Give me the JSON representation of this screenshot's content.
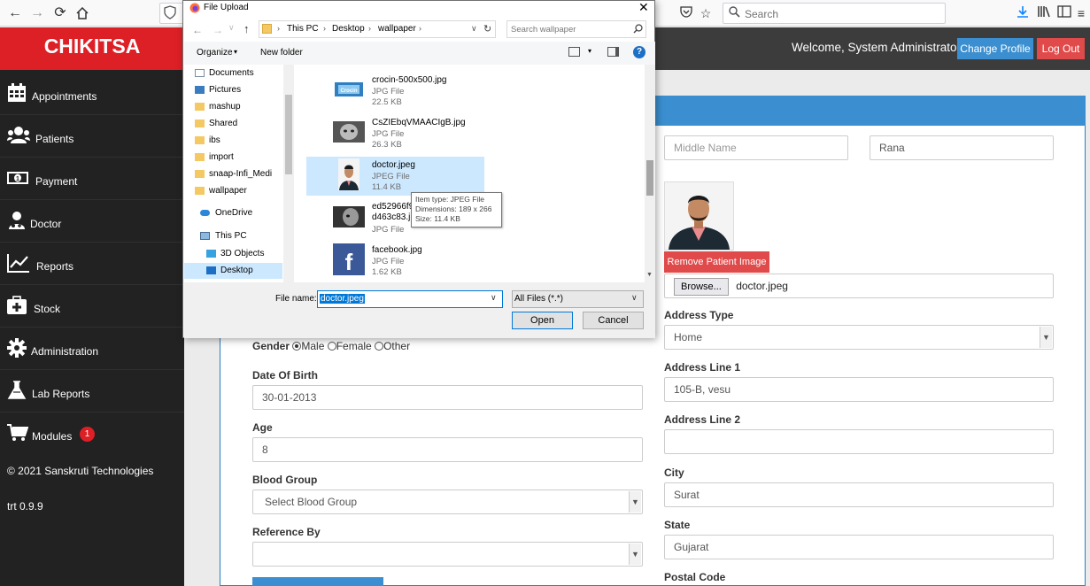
{
  "browser": {
    "search_placeholder": "Search"
  },
  "brand": "CHIKITSA",
  "sidebar": {
    "items": [
      {
        "label": "Appointments",
        "icon": "calendar-icon"
      },
      {
        "label": "Patients",
        "icon": "users-icon"
      },
      {
        "label": "Payment",
        "icon": "money-icon"
      },
      {
        "label": "Doctor",
        "icon": "doctor-icon"
      },
      {
        "label": "Reports",
        "icon": "line-chart-icon"
      },
      {
        "label": "Stock",
        "icon": "medkit-icon"
      },
      {
        "label": "Administration",
        "icon": "gear-icon"
      },
      {
        "label": "Lab Reports",
        "icon": "flask-icon"
      },
      {
        "label": "Modules",
        "icon": "cart-icon",
        "badge": "1"
      }
    ],
    "copyright": "© 2021 Sanskruti Technologies",
    "version": "trt 0.9.9"
  },
  "header": {
    "welcome": "Welcome, System Administrator",
    "change_profile": "Change Profile",
    "logout": "Log Out"
  },
  "form": {
    "middle_name_placeholder": "Middle Name",
    "last_name": "Rana",
    "remove_image": "Remove Patient Image",
    "browse": "Browse...",
    "browse_file": "doctor.jpeg",
    "gender_label": "Gender",
    "gender_options": [
      "Male",
      "Female",
      "Other"
    ],
    "gender_selected": "Male",
    "dob_label": "Date Of Birth",
    "dob": "30-01-2013",
    "age_label": "Age",
    "age": "8",
    "blood_group_label": "Blood Group",
    "blood_group": "Select Blood Group",
    "reference_label": "Reference By",
    "reference": "",
    "address_type_label": "Address Type",
    "address_type": "Home",
    "address1_label": "Address Line 1",
    "address1": "105-B, vesu",
    "address2_label": "Address Line 2",
    "address2": "",
    "city_label": "City",
    "city": "Surat",
    "state_label": "State",
    "state": "Gujarat",
    "postal_label": "Postal Code"
  },
  "dialog": {
    "title": "File Upload",
    "breadcrumb": [
      "This PC",
      "Desktop",
      "wallpaper"
    ],
    "search_placeholder": "Search wallpaper",
    "organize": "Organize",
    "new_folder": "New folder",
    "tree": [
      {
        "label": "Documents",
        "pinned": true
      },
      {
        "label": "Pictures",
        "pinned": true
      },
      {
        "label": "mashup",
        "pinned": true
      },
      {
        "label": "Shared",
        "pinned": true
      },
      {
        "label": "ibs",
        "pinned": false
      },
      {
        "label": "import",
        "pinned": false
      },
      {
        "label": "snaap-Infi_Medi",
        "pinned": false
      },
      {
        "label": "wallpaper",
        "pinned": false
      },
      {
        "label": "OneDrive",
        "pinned": false
      },
      {
        "label": "This PC",
        "pinned": false
      },
      {
        "label": "3D Objects",
        "pinned": false
      },
      {
        "label": "Desktop",
        "pinned": false
      }
    ],
    "files": [
      {
        "name": "crocin-500x500.jpg",
        "type": "JPG File",
        "size": "22.5 KB"
      },
      {
        "name": "CsZIEbqVMAACIgB.jpg",
        "type": "JPG File",
        "size": "26.3 KB"
      },
      {
        "name": "doctor.jpeg",
        "type": "JPEG File",
        "size": "11.4 KB"
      },
      {
        "name": "ed52966f9\nd463c83.jp",
        "type": "JPG File",
        "size": ""
      },
      {
        "name": "facebook.jpg",
        "type": "JPG File",
        "size": "1.62 KB"
      }
    ],
    "tooltip": {
      "type": "Item type: JPEG File",
      "dimensions": "Dimensions: 189 x 266",
      "size": "Size: 11.4 KB"
    },
    "file_name_label": "File name:",
    "file_name_value": "doctor.jpeg",
    "filter": "All Files (*.*)",
    "open": "Open",
    "cancel": "Cancel"
  },
  "colors": {
    "brand_red": "#dd1f26",
    "sidebar_bg": "#222222",
    "header_bg": "#3c3c3c",
    "primary_blue": "#3b8fd0",
    "danger": "#e04a4a",
    "selection": "#cce8ff"
  }
}
